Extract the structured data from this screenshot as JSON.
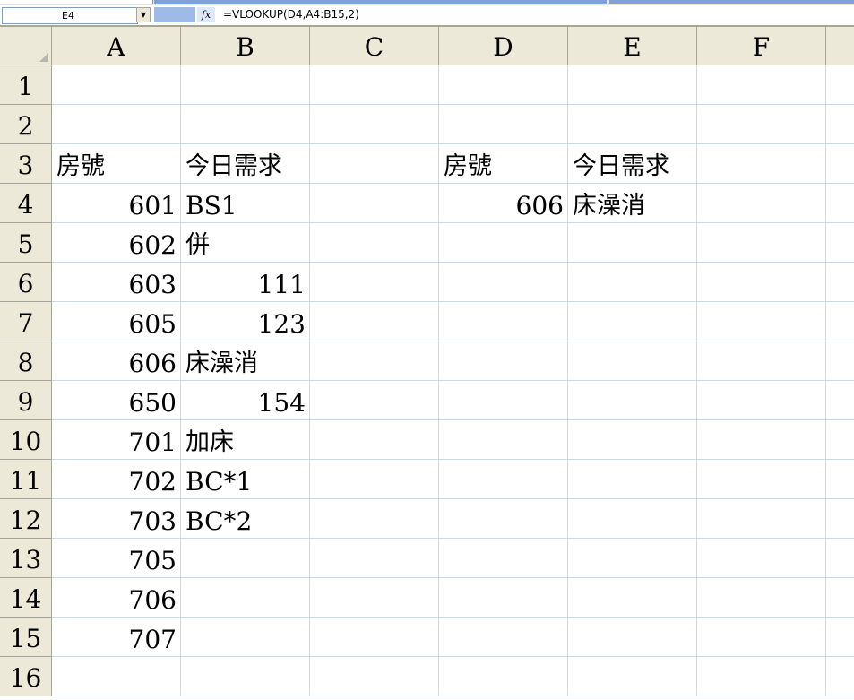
{
  "formula_bar": {
    "name_box": "E4",
    "name_box_dropdown": "▼",
    "fx_label": "fx",
    "formula": "=VLOOKUP(D4,A4:B15,2)"
  },
  "columns": [
    "A",
    "B",
    "C",
    "D",
    "E",
    "F"
  ],
  "rows": [
    "1",
    "2",
    "3",
    "4",
    "5",
    "6",
    "7",
    "8",
    "9",
    "10",
    "11",
    "12",
    "13",
    "14",
    "15",
    "16"
  ],
  "cells": {
    "A3": "房號",
    "B3": "今日需求",
    "D3": "房號",
    "E3": "今日需求",
    "A4": "601",
    "B4": "BS1",
    "D4": "606",
    "E4": "床澡消",
    "A5": "602",
    "B5": "併",
    "A6": "603",
    "B6": "111",
    "A7": "605",
    "B7": "123",
    "A8": "606",
    "B8": "床澡消",
    "A9": "650",
    "B9": "154",
    "A10": "701",
    "B10": "加床",
    "A11": "702",
    "B11": "BC*1",
    "A12": "703",
    "B12": "BC*2",
    "A13": "705",
    "A14": "706",
    "A15": "707"
  }
}
